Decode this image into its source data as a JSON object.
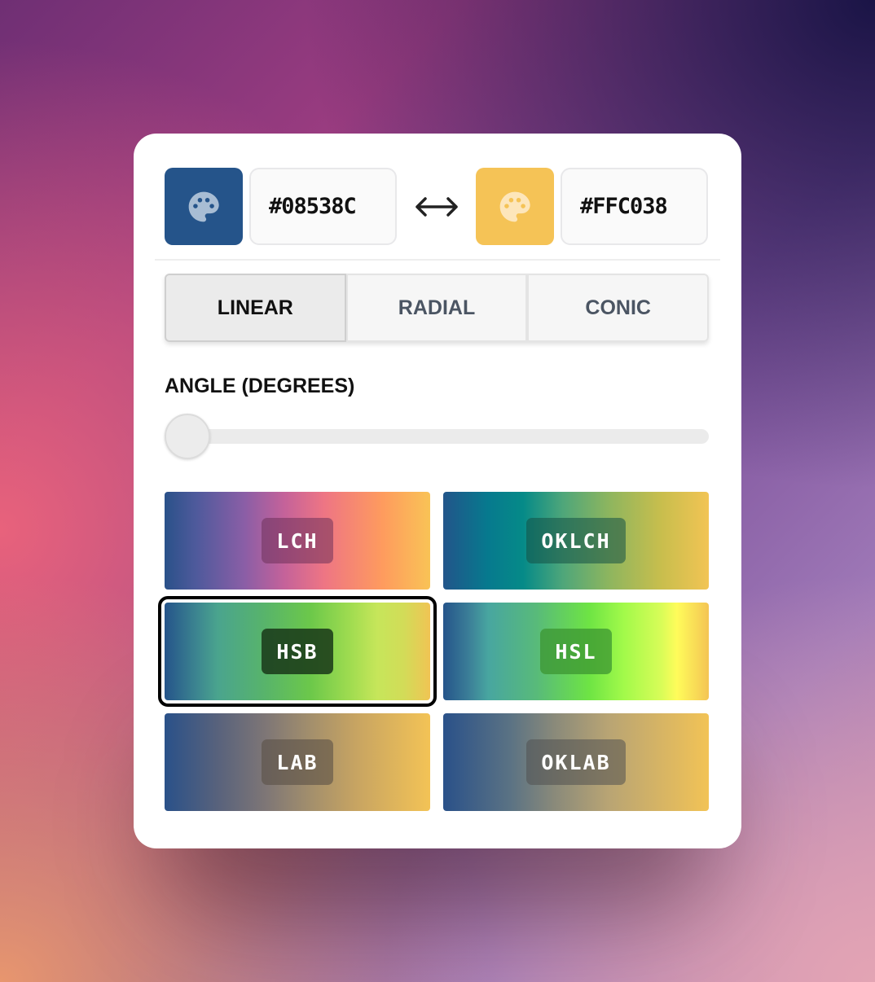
{
  "colors": {
    "start": "#08538C",
    "end": "#FFC038"
  },
  "start_color": {
    "icon": "palette-icon",
    "value": "#08538C"
  },
  "end_color": {
    "icon": "palette-icon",
    "value": "#FFC038"
  },
  "swap_icon": "left-right-arrow-icon",
  "gradient_types": [
    {
      "label": "LINEAR",
      "active": true
    },
    {
      "label": "RADIAL",
      "active": false
    },
    {
      "label": "CONIC",
      "active": false
    }
  ],
  "angle": {
    "label": "ANGLE (DEGREES)",
    "value": 0
  },
  "color_spaces": [
    {
      "label": "LCH",
      "selected": false
    },
    {
      "label": "OKLCH",
      "selected": false
    },
    {
      "label": "HSB",
      "selected": true
    },
    {
      "label": "HSL",
      "selected": false
    },
    {
      "label": "LAB",
      "selected": false
    },
    {
      "label": "OKLAB",
      "selected": false
    }
  ]
}
